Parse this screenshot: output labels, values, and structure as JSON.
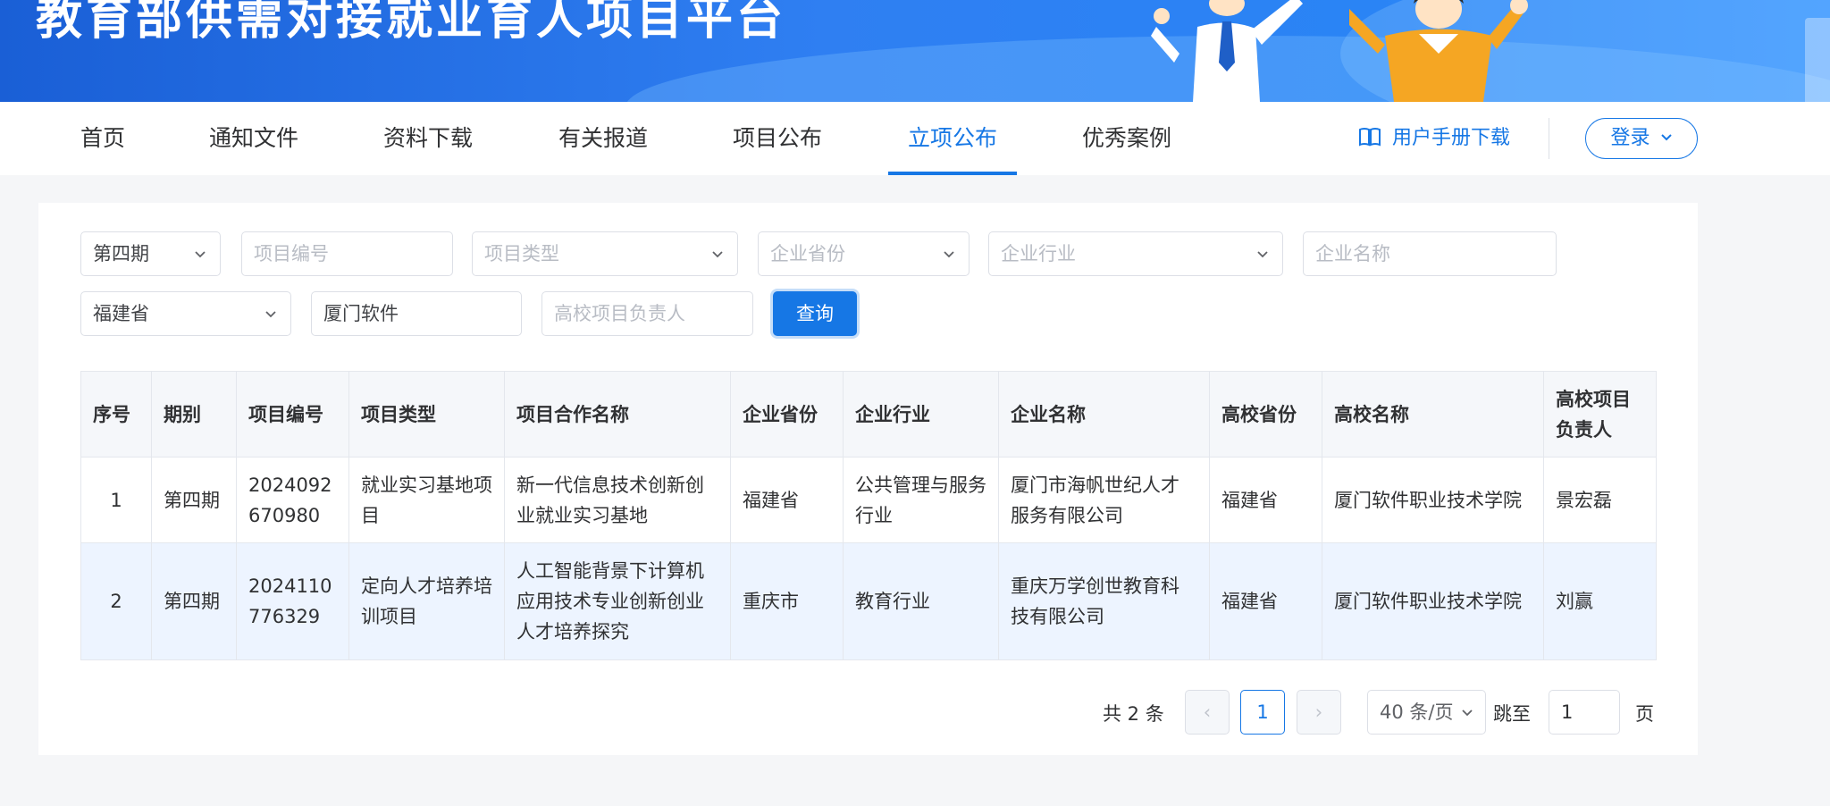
{
  "banner": {
    "title": "教育部供需对接就业育人项目平台"
  },
  "nav": {
    "items": [
      "首页",
      "通知文件",
      "资料下载",
      "有关报道",
      "项目公布",
      "立项公布",
      "优秀案例"
    ],
    "active_index": 5,
    "manual_label": "用户手册下载",
    "login_label": "登录"
  },
  "filters": {
    "period": "第四期",
    "project_no_placeholder": "项目编号",
    "project_type_placeholder": "项目类型",
    "company_province_placeholder": "企业省份",
    "company_industry_placeholder": "企业行业",
    "company_name_placeholder": "企业名称",
    "school_province": "福建省",
    "school_name": "厦门软件",
    "school_leader_placeholder": "高校项目负责人",
    "query_label": "查询"
  },
  "table": {
    "headers": [
      "序号",
      "期别",
      "项目编号",
      "项目类型",
      "项目合作名称",
      "企业省份",
      "企业行业",
      "企业名称",
      "高校省份",
      "高校名称",
      "高校项目负责人"
    ],
    "rows": [
      [
        "1",
        "第四期",
        "2024092670980",
        "就业实习基地项目",
        "新一代信息技术创新创业就业实习基地",
        "福建省",
        "公共管理与服务行业",
        "厦门市海帆世纪人才服务有限公司",
        "福建省",
        "厦门软件职业技术学院",
        "景宏磊"
      ],
      [
        "2",
        "第四期",
        "2024110776329",
        "定向人才培养培训项目",
        "人工智能背景下计算机应用技术专业创新创业人才培养探究",
        "重庆市",
        "教育行业",
        "重庆万学创世教育科技有限公司",
        "福建省",
        "厦门软件职业技术学院",
        "刘赢"
      ]
    ]
  },
  "pagination": {
    "total": "共 2 条",
    "prev": "‹",
    "current": "1",
    "next": "›",
    "page_size": "40 条/页",
    "jump_label": "跳至",
    "jump_value": "1",
    "page_unit": "页"
  },
  "colors": {
    "primary": "#1677e5",
    "banner": "#2f7ff2",
    "row_highlight": "#edf4ff"
  }
}
